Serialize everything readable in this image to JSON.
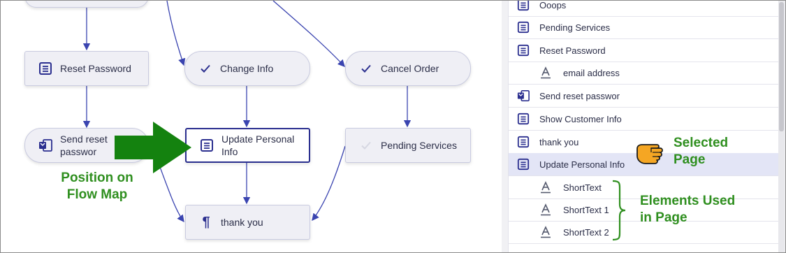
{
  "flow_map": {
    "nodes": {
      "reset_password": "Reset Password",
      "change_info": "Change Info",
      "cancel_order": "Cancel Order",
      "send_reset": "Send reset passwor",
      "update_personal": "Update Personal Info",
      "pending_services": "Pending Services",
      "thank_you": "thank you"
    },
    "callout": "Position on Flow Map"
  },
  "page_list": {
    "rows": [
      {
        "label": "Ooops",
        "type": "page",
        "icon": "page-icon"
      },
      {
        "label": "Pending Services",
        "type": "page",
        "icon": "page-icon"
      },
      {
        "label": "Reset Password",
        "type": "page",
        "icon": "page-icon"
      },
      {
        "label": "email address",
        "type": "element",
        "icon": "text-element-icon"
      },
      {
        "label": "Send reset passwor",
        "type": "page",
        "icon": "email-page-icon"
      },
      {
        "label": "Show Customer Info",
        "type": "page",
        "icon": "page-icon"
      },
      {
        "label": "thank you",
        "type": "page",
        "icon": "page-icon"
      },
      {
        "label": "Update Personal Info",
        "type": "page",
        "icon": "page-icon",
        "selected": true
      },
      {
        "label": "ShortText",
        "type": "element",
        "icon": "text-element-icon"
      },
      {
        "label": "ShortText 1",
        "type": "element",
        "icon": "text-element-icon"
      },
      {
        "label": "ShortText 2",
        "type": "element",
        "icon": "text-element-icon"
      }
    ]
  },
  "annotations": {
    "selected_page": "Selected Page",
    "elements_used": "Elements Used in Page"
  },
  "colors": {
    "accent": "#2b2f8f",
    "edge": "#3a44b0",
    "callout_green": "#2f8f1f",
    "selected_row": "#e3e5f6"
  }
}
